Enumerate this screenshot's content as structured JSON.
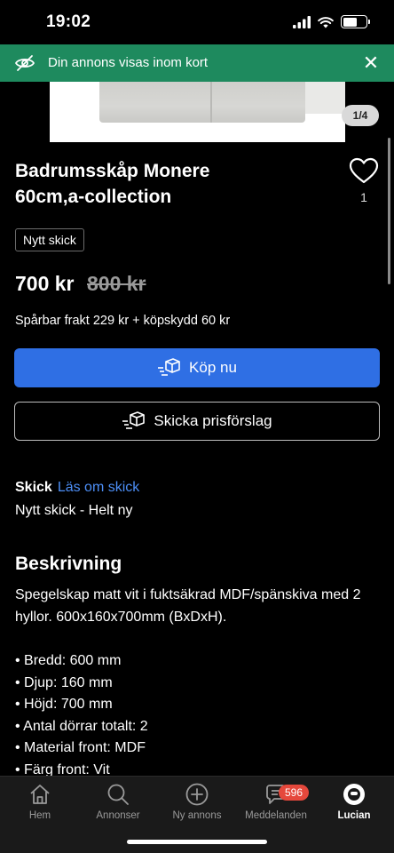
{
  "status": {
    "time": "19:02"
  },
  "banner": {
    "text": "Din annons visas inom kort"
  },
  "gallery": {
    "counter": "1/4"
  },
  "listing": {
    "title": "Badrumsskåp Monere 60cm,a-collection",
    "favorites_count": "1",
    "condition_badge": "Nytt skick",
    "price": "700 kr",
    "original_price": "800 kr",
    "shipping": "Spårbar frakt 229 kr + köpskydd 60 kr"
  },
  "actions": {
    "buy_label": "Köp nu",
    "offer_label": "Skicka prisförslag"
  },
  "condition": {
    "label": "Skick",
    "link": "Läs om skick",
    "value": "Nytt skick - Helt ny"
  },
  "description": {
    "heading": "Beskrivning",
    "text": "Spegelskap matt vit i fuktsäkrad MDF/spänskiva med 2 hyllor. 600x160x700mm (BxDxH).",
    "bullets": [
      "Bredd: 600 mm",
      "Djup: 160 mm",
      "Höjd: 700 mm",
      "Antal dörrar totalt: 2",
      "Material front: MDF",
      "Färg front: Vit"
    ]
  },
  "tabbar": {
    "tabs": [
      {
        "label": "Hem",
        "icon": "home-icon"
      },
      {
        "label": "Annonser",
        "icon": "search-icon"
      },
      {
        "label": "Ny annons",
        "icon": "plus-circle-icon"
      },
      {
        "label": "Meddelanden",
        "icon": "chat-icon",
        "badge": "596"
      },
      {
        "label": "Lucian",
        "icon": "profile-icon"
      }
    ]
  },
  "colors": {
    "banner": "#1e8a5e",
    "primary_button": "#2f6fe4",
    "link": "#4d8ff7",
    "badge": "#e5483c"
  }
}
